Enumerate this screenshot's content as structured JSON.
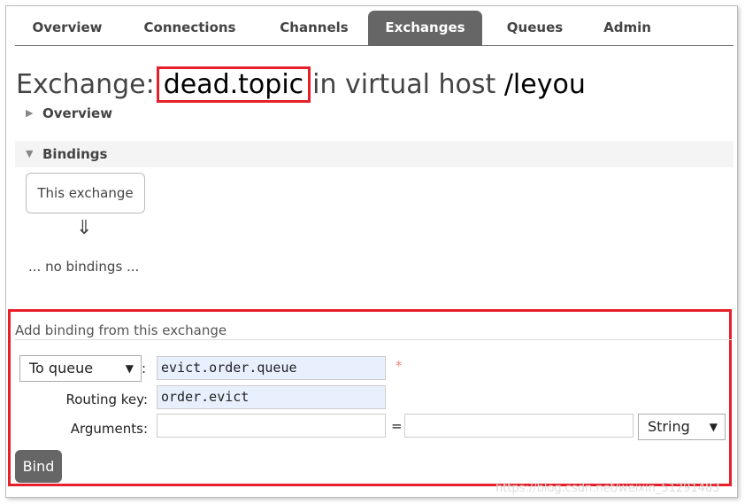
{
  "nav": {
    "tabs": [
      {
        "label": "Overview"
      },
      {
        "label": "Connections"
      },
      {
        "label": "Channels"
      },
      {
        "label": "Exchanges",
        "active": true
      },
      {
        "label": "Queues"
      },
      {
        "label": "Admin"
      }
    ]
  },
  "header": {
    "prefix": "Exchange:",
    "name": "dead.topic",
    "middle": "in virtual host",
    "vhost": "/leyou"
  },
  "sections": {
    "overview": "Overview",
    "bindings": "Bindings"
  },
  "bindings": {
    "this_exchange": "This exchange",
    "arrow": "⇓",
    "empty": "... no bindings ..."
  },
  "form": {
    "title": "Add binding from this exchange",
    "destination_type": "To queue",
    "colon": ":",
    "destination": "evict.order.queue",
    "required": "*",
    "routing_key_label": "Routing key:",
    "routing_key": "order.evict",
    "arguments_label": "Arguments:",
    "equals": "=",
    "arg_type": "String",
    "bind_label": "Bind"
  },
  "watermark": "https://blog.csdn.net/weixin_51291483",
  "colors": {
    "active_tab": "#666666",
    "highlight": "#e5202a",
    "autofill": "#e8f0fe"
  }
}
